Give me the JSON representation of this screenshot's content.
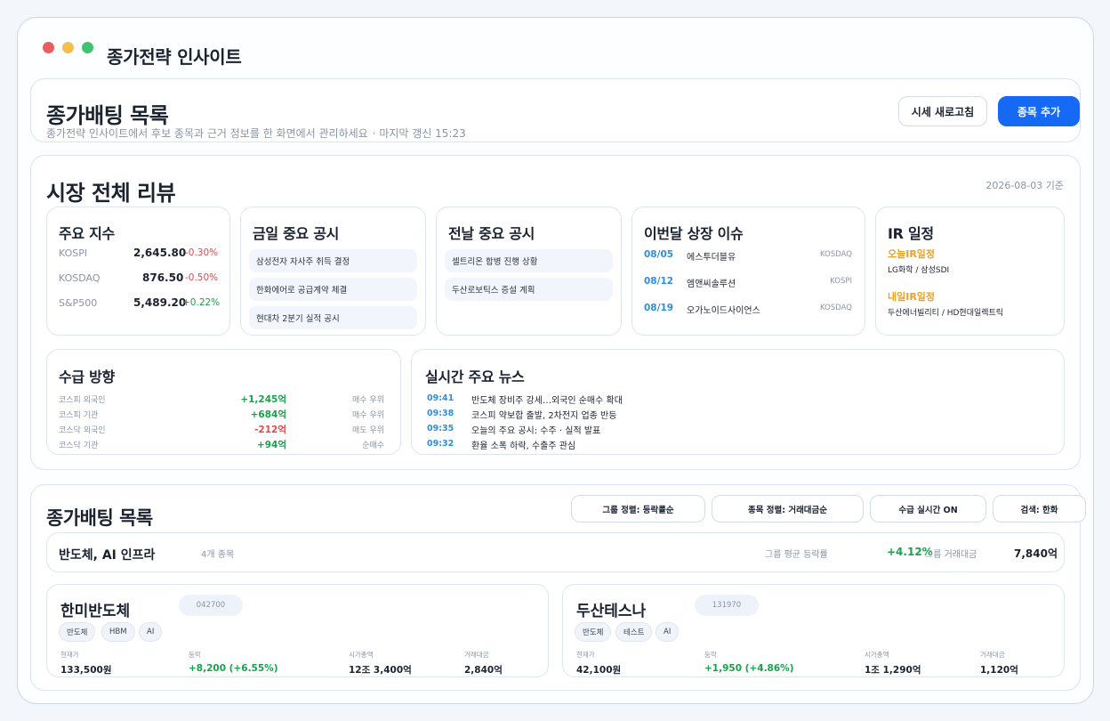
{
  "app": {
    "title": "종가전략 인사이트"
  },
  "header": {
    "title": "종가배팅 목록",
    "subtitle": "종가전략 인사이트에서 후보 종목과 근거 정보를 한 화면에서 관리하세요",
    "updated": "· 마지막 갱신 15:23",
    "refresh_label": "시세 새로고침",
    "add_label": "종목 추가"
  },
  "market": {
    "title": "시장 전체 리뷰",
    "date": "2026-08-03 기준",
    "indices": {
      "title": "주요 지수",
      "rows": [
        {
          "name": "KOSPI",
          "value": "2,645.80",
          "change": "-0.30%"
        },
        {
          "name": "KOSDAQ",
          "value": "876.50",
          "change": "-0.50%"
        },
        {
          "name": "S&P500",
          "value": "5,489.20",
          "change": "+0.22%"
        }
      ]
    },
    "today_disclosures": {
      "title": "금일 중요 공시",
      "items": [
        "삼성전자 자사주 취득 결정",
        "한화에어로 공급계약 체결",
        "현대차 2분기 실적 공시"
      ]
    },
    "prev_disclosures": {
      "title": "전날 중요 공시",
      "items": [
        "셀트리온 합병 진행 상황",
        "두산로보틱스 증설 계획"
      ]
    },
    "listing": {
      "title": "이번달 상장 이슈",
      "rows": [
        {
          "date": "08/05",
          "name": "에스투더블유",
          "market": "KOSDAQ"
        },
        {
          "date": "08/12",
          "name": "엠앤씨솔루션",
          "market": "KOSPI"
        },
        {
          "date": "08/19",
          "name": "오가노이드사이언스",
          "market": "KOSDAQ"
        }
      ]
    },
    "ir": {
      "title": "IR 일정",
      "today_label": "오늘IR일정",
      "today_value": "LG화학 / 삼성SDI",
      "tomorrow_label": "내일IR일정",
      "tomorrow_value": "두산에너빌리티 / HD현대일렉트릭"
    },
    "flows": {
      "title": "수급 방향",
      "rows": [
        {
          "name": "코스피 외국인",
          "value": "+1,245억",
          "dir": "매수 우위"
        },
        {
          "name": "코스피 기관",
          "value": "+684억",
          "dir": "매수 우위"
        },
        {
          "name": "코스닥 외국인",
          "value": "-212억",
          "dir": "매도 우위"
        },
        {
          "name": "코스닥 기관",
          "value": "+94억",
          "dir": "순매수"
        }
      ]
    },
    "news": {
      "title": "실시간 주요 뉴스",
      "rows": [
        {
          "time": "09:41",
          "text": "반도체 장비주 강세…외국인 순매수 확대"
        },
        {
          "time": "09:38",
          "text": "코스피 약보합 출발, 2차전지 업종 반등"
        },
        {
          "time": "09:35",
          "text": "오늘의 주요 공시: 수주 · 실적 발표"
        },
        {
          "time": "09:32",
          "text": "환율 소폭 하락, 수출주 관심"
        }
      ]
    }
  },
  "list": {
    "title": "종가배팅 목록",
    "filters": [
      "그룹 정렬: 등락률순",
      "종목 정렬: 거래대금순",
      "수급 실시간 ON",
      "검색: 한화"
    ],
    "group": {
      "name": "반도체, AI 인프라",
      "count": "4개 종목",
      "avg_label": "그룹 평균 등락률",
      "avg_value": "+4.12%",
      "volume_label": "그룹 거래대금",
      "volume_value": "7,840억"
    },
    "stocks": [
      {
        "name": "한미반도체",
        "code": "042700",
        "tags": [
          "반도체",
          "HBM",
          "AI"
        ],
        "labels": [
          "현재가",
          "등락",
          "시가총액",
          "거래대금"
        ],
        "values": [
          "133,500원",
          "+8,200 (+6.55%)",
          "12조 3,400억",
          "2,840억"
        ]
      },
      {
        "name": "두산테스나",
        "code": "131970",
        "tags": [
          "반도체",
          "테스트",
          "AI"
        ],
        "labels": [
          "현재가",
          "등락",
          "시가총액",
          "거래대금"
        ],
        "values": [
          "42,100원",
          "+1,950 (+4.86%)",
          "1조 1,290억",
          "1,120억"
        ]
      }
    ]
  },
  "colors": {
    "accent": "#1569f5",
    "up": "#17a34a",
    "down": "#e5484d",
    "time": "#2f8fdc",
    "ir": "#e8a227"
  }
}
